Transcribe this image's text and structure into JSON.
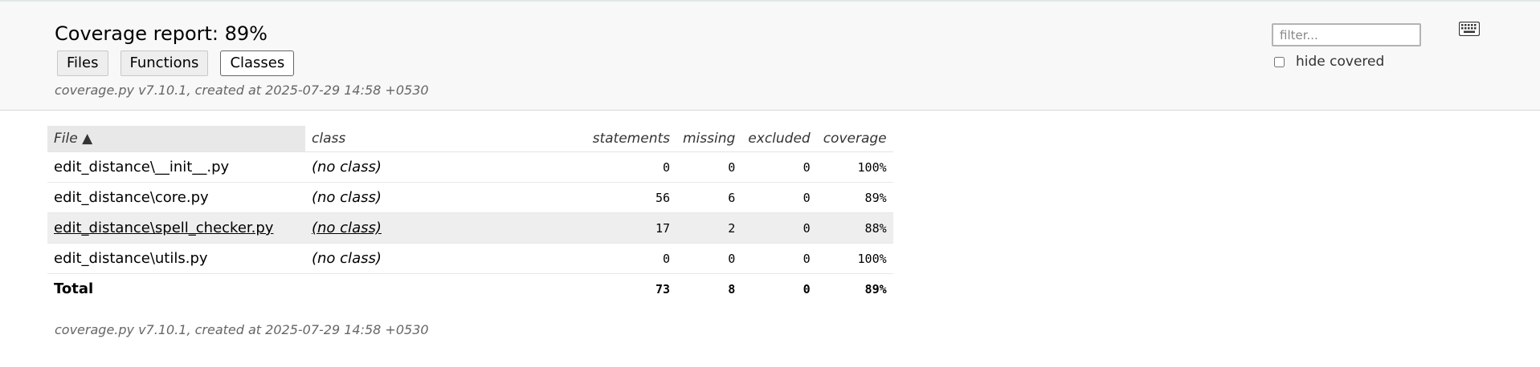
{
  "header": {
    "title": "Coverage report: 89%",
    "tabs": [
      {
        "label": "Files"
      },
      {
        "label": "Functions"
      },
      {
        "label": "Classes"
      }
    ],
    "created": "coverage.py v7.10.1, created at 2025-07-29 14:58 +0530",
    "filter_placeholder": "filter...",
    "hide_covered_label": "hide covered"
  },
  "icons": {
    "keyboard": "keyboard-icon"
  },
  "table": {
    "columns": [
      "File ▲",
      "class",
      "statements",
      "missing",
      "excluded",
      "coverage"
    ],
    "rows": [
      {
        "file": "edit_distance\\__init__.py",
        "class": "(no class)",
        "statements": "0",
        "missing": "0",
        "excluded": "0",
        "coverage": "100%"
      },
      {
        "file": "edit_distance\\core.py",
        "class": "(no class)",
        "statements": "56",
        "missing": "6",
        "excluded": "0",
        "coverage": "89%"
      },
      {
        "file": "edit_distance\\spell_checker.py",
        "class": "(no class)",
        "statements": "17",
        "missing": "2",
        "excluded": "0",
        "coverage": "88%"
      },
      {
        "file": "edit_distance\\utils.py",
        "class": "(no class)",
        "statements": "0",
        "missing": "0",
        "excluded": "0",
        "coverage": "100%"
      }
    ],
    "total": {
      "label": "Total",
      "statements": "73",
      "missing": "8",
      "excluded": "0",
      "coverage": "89%"
    }
  },
  "footer": {
    "created": "coverage.py v7.10.1, created at 2025-07-29 14:58 +0530"
  }
}
